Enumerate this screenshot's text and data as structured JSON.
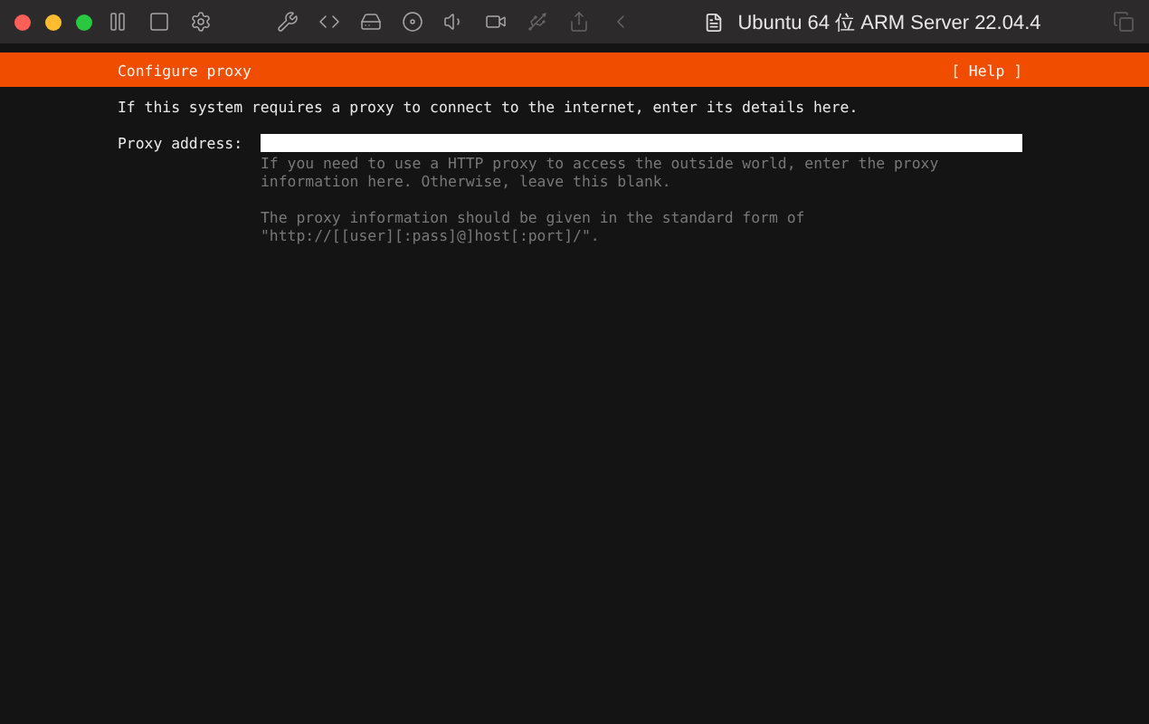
{
  "window": {
    "title": "Ubuntu 64 位 ARM Server 22.04.4"
  },
  "header": {
    "title": "Configure proxy",
    "help": "[ Help ]"
  },
  "intro": "If this system requires a proxy to connect to the internet, enter its details here.",
  "field": {
    "label": "Proxy address:"
  },
  "help_paragraphs": [
    [
      "If you need to use a HTTP proxy to access the outside world, enter the proxy",
      "information here. Otherwise, leave this blank."
    ],
    [
      "The proxy information should be given in the standard form of",
      "\"http://[[user][:pass]@]host[:port]/\"."
    ]
  ]
}
